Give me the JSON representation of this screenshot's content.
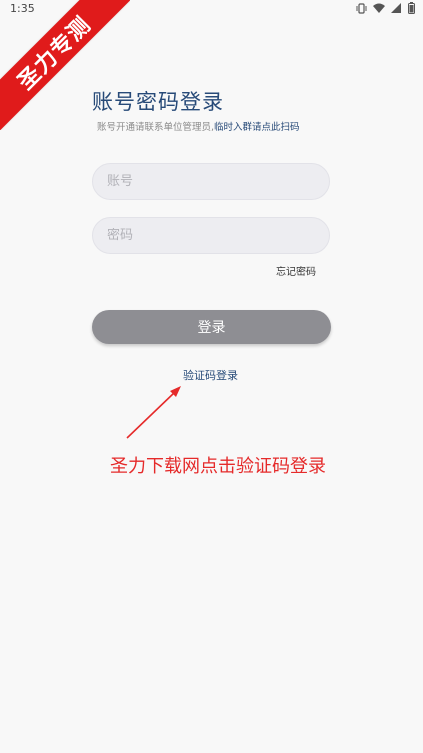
{
  "status_bar": {
    "time": "1:35",
    "icons": [
      "vibrate-icon",
      "wifi-icon",
      "signal-icon",
      "battery-icon"
    ]
  },
  "watermark": {
    "text": "圣力专测",
    "color": "#e01b1b"
  },
  "login": {
    "title": "账号密码登录",
    "subtitle_prefix": "账号开通请联系单位管理员,",
    "subtitle_link": "临时入群请点此扫码",
    "account_placeholder": "账号",
    "password_placeholder": "密码",
    "forgot_password": "忘记密码",
    "login_button": "登录",
    "sms_login": "验证码登录"
  },
  "annotation": {
    "text": "圣力下载网点击验证码登录",
    "color": "#e52a2a"
  },
  "colors": {
    "accent": "#274a78",
    "button_bg": "#8e8e93",
    "page_bg": "#f8f8f8"
  }
}
